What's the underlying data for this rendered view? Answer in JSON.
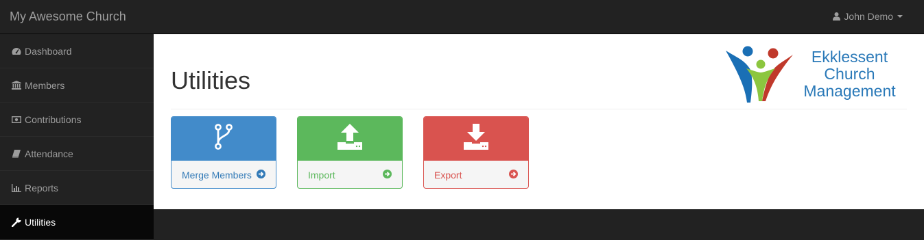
{
  "app": {
    "brand": "My Awesome Church"
  },
  "user": {
    "name": "John Demo"
  },
  "sidebar": {
    "items": [
      {
        "label": "Dashboard",
        "icon": "dashboard-icon"
      },
      {
        "label": "Members",
        "icon": "bank-icon"
      },
      {
        "label": "Contributions",
        "icon": "money-icon"
      },
      {
        "label": "Attendance",
        "icon": "book-icon"
      },
      {
        "label": "Reports",
        "icon": "bar-chart-icon"
      },
      {
        "label": "Utilities",
        "icon": "wrench-icon",
        "active": true
      }
    ]
  },
  "main": {
    "title": "Utilities",
    "logo": {
      "line1": "Ekklessent",
      "line2": "Church",
      "line3": "Management"
    },
    "tiles": [
      {
        "label": "Merge Members",
        "icon": "code-fork-icon",
        "color": "#428bca"
      },
      {
        "label": "Import",
        "icon": "upload-icon",
        "color": "#5cb85c"
      },
      {
        "label": "Export",
        "icon": "download-icon",
        "color": "#d9534f"
      }
    ]
  },
  "colors": {
    "navbar": "#222222",
    "active_nav": "#080808",
    "primary": "#428bca",
    "success": "#5cb85c",
    "danger": "#d9534f"
  }
}
